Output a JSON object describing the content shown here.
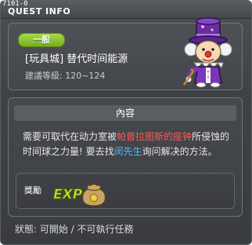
{
  "window": {
    "quest_id": "7101-0",
    "title": "QUEST INFO"
  },
  "header": {
    "badge": "一般",
    "quest_name": "[玩具城] 替代时间能源",
    "level": "建議等級: 120~124"
  },
  "content": {
    "section_title": "內容",
    "desc_part1": "需要可取代在动力室被",
    "desc_highlight_red": "帕普拉图斯的座钟",
    "desc_part2": "所侵蚀的时间球之力量! 要去找",
    "desc_highlight_blue": "闵先生",
    "desc_part3": "询问解决的方法。"
  },
  "reward": {
    "label": "獎勵",
    "exp_text": "EXP"
  },
  "status": {
    "text": "狀態: 可開始 / 不可執行任務"
  },
  "colors": {
    "badge_green": "#8bc43a",
    "highlight_red": "#ff5a5a",
    "highlight_blue": "#46b9ff",
    "panel_bg": "#45484c"
  },
  "icons": [
    "npc-clown-icon",
    "exp-icon",
    "money-bag-icon"
  ]
}
